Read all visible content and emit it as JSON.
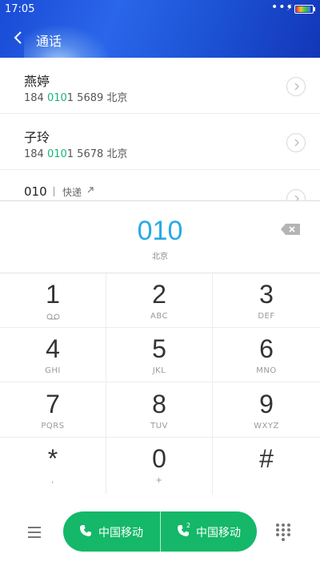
{
  "status_bar": {
    "time": "17:05",
    "dots": "•••",
    "battery_level": 0.9
  },
  "header": {
    "title": "通话"
  },
  "contacts": [
    {
      "name": "燕婷",
      "num_prefix": "184 ",
      "num_match": "010",
      "num_suffix": "1 5689",
      "location": "北京"
    },
    {
      "name": "子玲",
      "num_prefix": "184 ",
      "num_match": "010",
      "num_suffix": "1 5678",
      "location": "北京"
    }
  ],
  "express": {
    "number": "010",
    "tag": "快递"
  },
  "dialer": {
    "number": "010",
    "location": "北京"
  },
  "keypad": [
    {
      "digit": "1",
      "sub": ""
    },
    {
      "digit": "2",
      "sub": "ABC"
    },
    {
      "digit": "3",
      "sub": "DEF"
    },
    {
      "digit": "4",
      "sub": "GHI"
    },
    {
      "digit": "5",
      "sub": "JKL"
    },
    {
      "digit": "6",
      "sub": "MNO"
    },
    {
      "digit": "7",
      "sub": "PQRS"
    },
    {
      "digit": "8",
      "sub": "TUV"
    },
    {
      "digit": "9",
      "sub": "WXYZ"
    },
    {
      "digit": "*",
      "sub": ","
    },
    {
      "digit": "0",
      "sub": "+"
    },
    {
      "digit": "#",
      "sub": ""
    }
  ],
  "call_buttons": [
    {
      "label": "中国移动",
      "sim": ""
    },
    {
      "label": "中国移动",
      "sim": "2"
    }
  ],
  "icons": {
    "back": "chevron-left-icon",
    "backspace": "backspace-icon",
    "voicemail": "voicemail-icon",
    "menu": "menu-icon",
    "dialpad": "dialpad-icon",
    "call": "phone-icon",
    "chevron": "chevron-right-icon"
  },
  "colors": {
    "accent": "#27a9e6",
    "call_green": "#14b868",
    "match_green": "#1ab37a",
    "header_blue": "#2a66ea"
  }
}
